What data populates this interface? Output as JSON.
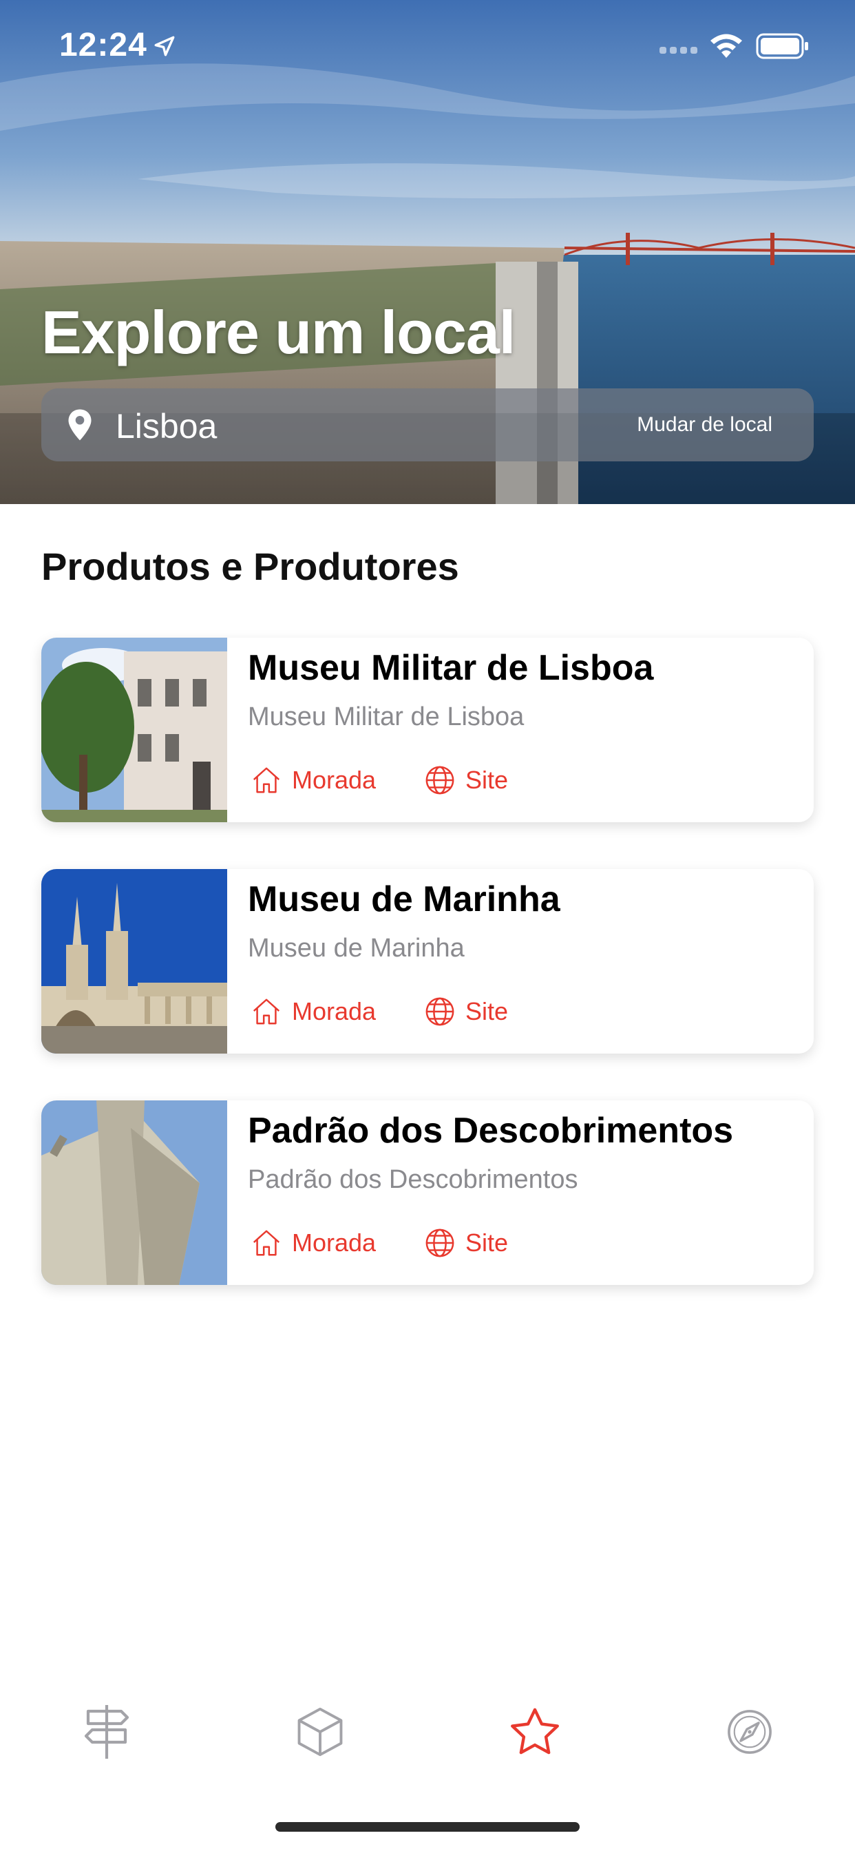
{
  "status_bar": {
    "time": "12:24"
  },
  "hero": {
    "title": "Explore um local",
    "location": {
      "current": "Lisboa",
      "change_label": "Mudar de local",
      "pin_icon": "location-pin-icon"
    }
  },
  "section": {
    "title": "Produtos e Produtores"
  },
  "cards": [
    {
      "title": "Museu Militar de Lisboa",
      "subtitle": "Museu Militar de Lisboa",
      "address_label": "Morada",
      "site_label": "Site"
    },
    {
      "title": "Museu de Marinha",
      "subtitle": "Museu de Marinha",
      "address_label": "Morada",
      "site_label": "Site"
    },
    {
      "title": "Padrão dos Descobrimentos",
      "subtitle": "Padrão dos Descobrimentos",
      "address_label": "Morada",
      "site_label": "Site"
    }
  ],
  "tab_bar": {
    "items": [
      {
        "icon": "signpost-icon",
        "active": false
      },
      {
        "icon": "cube-icon",
        "active": false
      },
      {
        "icon": "star-icon",
        "active": true
      },
      {
        "icon": "compass-icon",
        "active": false
      }
    ]
  },
  "colors": {
    "accent": "#e8392e",
    "inactive_icon": "#a3a3a8",
    "subtitle": "#8a8a8e"
  }
}
